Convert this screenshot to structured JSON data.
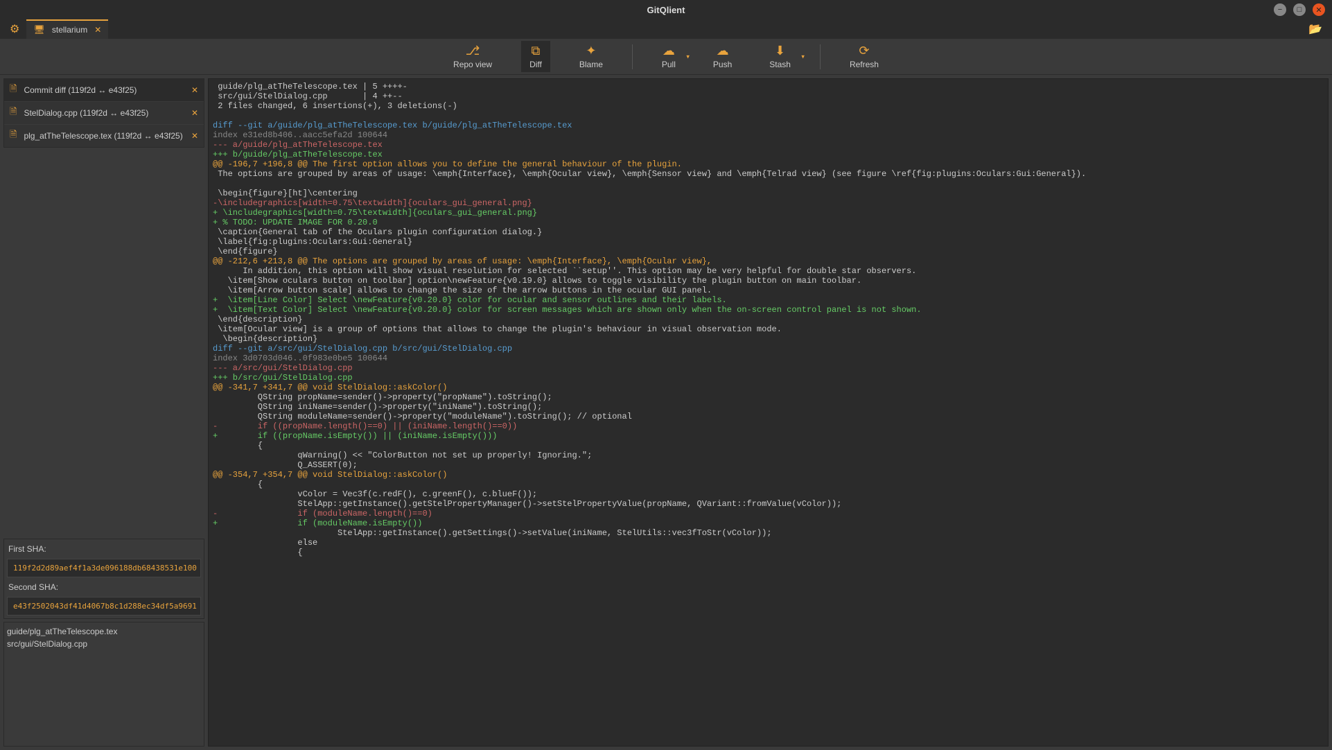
{
  "window": {
    "title": "GitQlient"
  },
  "tab": {
    "label": "stellarium"
  },
  "toolbar": {
    "repoview": "Repo view",
    "diff": "Diff",
    "blame": "Blame",
    "pull": "Pull",
    "push": "Push",
    "stash": "Stash",
    "refresh": "Refresh"
  },
  "diffTabs": [
    {
      "label": "Commit diff (119f2d ↔ e43f25)",
      "active": true
    },
    {
      "label": "StelDialog.cpp (119f2d ↔ e43f25)",
      "active": false
    },
    {
      "label": "plg_atTheTelescope.tex (119f2d ↔ e43f25)",
      "active": false
    }
  ],
  "sha": {
    "firstLabel": "First SHA:",
    "first": "119f2d2d89aef4f1a3de096188db68438531e100",
    "secondLabel": "Second SHA:",
    "second": "e43f2502043df41d4067b8c1d288ec34df5a9691"
  },
  "files": [
    "guide/plg_atTheTelescope.tex",
    "src/gui/StelDialog.cpp"
  ],
  "diffLines": [
    {
      "cls": "c-plain",
      "t": " guide/plg_atTheTelescope.tex | 5 ++++-"
    },
    {
      "cls": "c-plain",
      "t": " src/gui/StelDialog.cpp       | 4 ++--"
    },
    {
      "cls": "c-plain",
      "t": " 2 files changed, 6 insertions(+), 3 deletions(-)"
    },
    {
      "cls": "c-plain",
      "t": " "
    },
    {
      "cls": "c-cmd",
      "t": "diff --git a/guide/plg_atTheTelescope.tex b/guide/plg_atTheTelescope.tex"
    },
    {
      "cls": "c-index",
      "t": "index e31ed8b406..aacc5efa2d 100644"
    },
    {
      "cls": "c-remd",
      "t": "--- a/guide/plg_atTheTelescope.tex"
    },
    {
      "cls": "c-addd",
      "t": "+++ b/guide/plg_atTheTelescope.tex"
    },
    {
      "cls": "c-hunk",
      "t": "@@ -196,7 +196,8 @@ The first option allows you to define the general behaviour of the plugin."
    },
    {
      "cls": "c-plain",
      "t": " The options are grouped by areas of usage: \\emph{Interface}, \\emph{Ocular view}, \\emph{Sensor view} and \\emph{Telrad view} (see figure \\ref{fig:plugins:Oculars:Gui:General})."
    },
    {
      "cls": "c-plain",
      "t": " "
    },
    {
      "cls": "c-plain",
      "t": " \\begin{figure}[ht]\\centering"
    },
    {
      "cls": "c-rem",
      "t": "-\\includegraphics[width=0.75\\textwidth]{oculars_gui_general.png}"
    },
    {
      "cls": "c-add",
      "t": "+ \\includegraphics[width=0.75\\textwidth]{oculars_gui_general.png}"
    },
    {
      "cls": "c-add",
      "t": "+ % TODO: UPDATE IMAGE FOR 0.20.0"
    },
    {
      "cls": "c-plain",
      "t": " \\caption{General tab of the Oculars plugin configuration dialog.}"
    },
    {
      "cls": "c-plain",
      "t": " \\label{fig:plugins:Oculars:Gui:General}"
    },
    {
      "cls": "c-plain",
      "t": " \\end{figure}"
    },
    {
      "cls": "c-hunk",
      "t": "@@ -212,6 +213,8 @@ The options are grouped by areas of usage: \\emph{Interface}, \\emph{Ocular view},"
    },
    {
      "cls": "c-plain",
      "t": "      In addition, this option will show visual resolution for selected ``setup''. This option may be very helpful for double star observers."
    },
    {
      "cls": "c-plain",
      "t": "   \\item[Show oculars button on toolbar] option\\newFeature{v0.19.0} allows to toggle visibility the plugin button on main toolbar."
    },
    {
      "cls": "c-plain",
      "t": "   \\item[Arrow button scale] allows to change the size of the arrow buttons in the ocular GUI panel."
    },
    {
      "cls": "c-add",
      "t": "+  \\item[Line Color] Select \\newFeature{v0.20.0} color for ocular and sensor outlines and their labels."
    },
    {
      "cls": "c-add",
      "t": "+  \\item[Text Color] Select \\newFeature{v0.20.0} color for screen messages which are shown only when the on-screen control panel is not shown."
    },
    {
      "cls": "c-plain",
      "t": " \\end{description}"
    },
    {
      "cls": "c-plain",
      "t": " \\item[Ocular view] is a group of options that allows to change the plugin's behaviour in visual observation mode."
    },
    {
      "cls": "c-plain",
      "t": "  \\begin{description}"
    },
    {
      "cls": "c-cmd",
      "t": "diff --git a/src/gui/StelDialog.cpp b/src/gui/StelDialog.cpp"
    },
    {
      "cls": "c-index",
      "t": "index 3d0703d046..0f983e0be5 100644"
    },
    {
      "cls": "c-remd",
      "t": "--- a/src/gui/StelDialog.cpp"
    },
    {
      "cls": "c-addd",
      "t": "+++ b/src/gui/StelDialog.cpp"
    },
    {
      "cls": "c-hunk",
      "t": "@@ -341,7 +341,7 @@ void StelDialog::askColor()"
    },
    {
      "cls": "c-plain",
      "t": "         QString propName=sender()->property(\"propName\").toString();"
    },
    {
      "cls": "c-plain",
      "t": "         QString iniName=sender()->property(\"iniName\").toString();"
    },
    {
      "cls": "c-plain",
      "t": "         QString moduleName=sender()->property(\"moduleName\").toString(); // optional"
    },
    {
      "cls": "c-rem",
      "t": "-        if ((propName.length()==0) || (iniName.length()==0))"
    },
    {
      "cls": "c-add",
      "t": "+        if ((propName.isEmpty()) || (iniName.isEmpty()))"
    },
    {
      "cls": "c-plain",
      "t": "         {"
    },
    {
      "cls": "c-plain",
      "t": "                 qWarning() << \"ColorButton not set up properly! Ignoring.\";"
    },
    {
      "cls": "c-plain",
      "t": "                 Q_ASSERT(0);"
    },
    {
      "cls": "c-hunk",
      "t": "@@ -354,7 +354,7 @@ void StelDialog::askColor()"
    },
    {
      "cls": "c-plain",
      "t": "         {"
    },
    {
      "cls": "c-plain",
      "t": "                 vColor = Vec3f(c.redF(), c.greenF(), c.blueF());"
    },
    {
      "cls": "c-plain",
      "t": "                 StelApp::getInstance().getStelPropertyManager()->setStelPropertyValue(propName, QVariant::fromValue(vColor));"
    },
    {
      "cls": "c-rem",
      "t": "-                if (moduleName.length()==0)"
    },
    {
      "cls": "c-add",
      "t": "+                if (moduleName.isEmpty())"
    },
    {
      "cls": "c-plain",
      "t": "                         StelApp::getInstance().getSettings()->setValue(iniName, StelUtils::vec3fToStr(vColor));"
    },
    {
      "cls": "c-plain",
      "t": "                 else"
    },
    {
      "cls": "c-plain",
      "t": "                 {"
    }
  ]
}
